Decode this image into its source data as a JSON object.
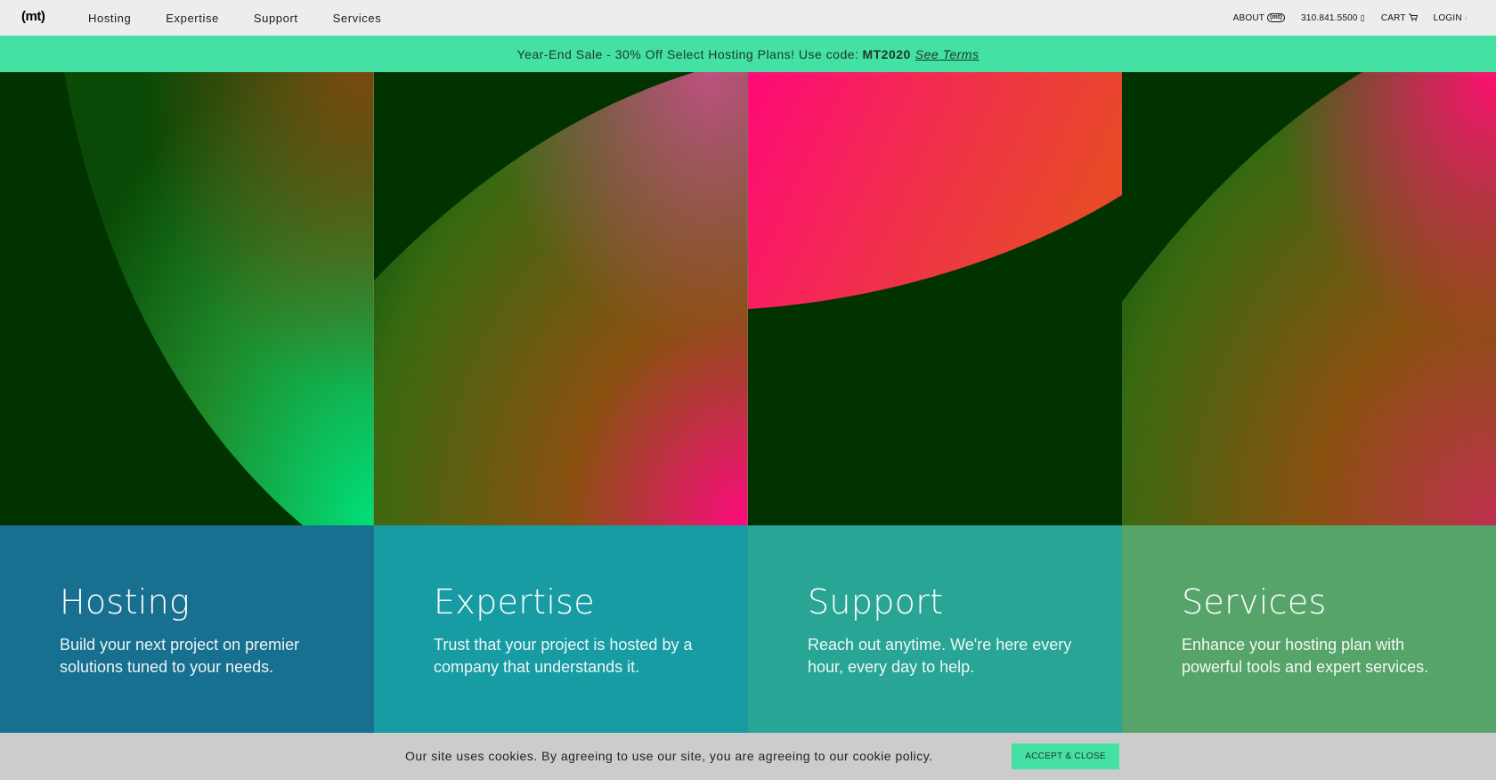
{
  "header": {
    "logo": "(mt)",
    "nav": [
      {
        "label": "Hosting"
      },
      {
        "label": "Expertise"
      },
      {
        "label": "Support"
      },
      {
        "label": "Services"
      }
    ],
    "utility": {
      "about_label": "ABOUT",
      "about_badge": "(mt)",
      "phone": "310.841.5500",
      "cart_label": "CART",
      "login_label": "LOGIN"
    }
  },
  "promo": {
    "text": "Year-End Sale - 30% Off Select Hosting Plans! Use code:",
    "code": "MT2020",
    "terms_label": "See Terms"
  },
  "cards": [
    {
      "title": "Hosting",
      "description": "Build your next project on premier solutions tuned to your needs.",
      "color": "#17708f"
    },
    {
      "title": "Expertise",
      "description": "Trust that your project is hosted by a company that understands it.",
      "color": "#189ca3"
    },
    {
      "title": "Support",
      "description": "Reach out anytime. We're here every hour, every day to help.",
      "color": "#29a595"
    },
    {
      "title": "Services",
      "description": "Enhance your hosting plan with powerful tools and expert services.",
      "color": "#56a46a"
    }
  ],
  "cookie": {
    "text": "Our site uses cookies. By agreeing to use our site, you are agreeing to our cookie policy.",
    "button_label": "ACCEPT & CLOSE"
  },
  "colors": {
    "accent": "#45e0a3",
    "hero_background": "#003300"
  }
}
